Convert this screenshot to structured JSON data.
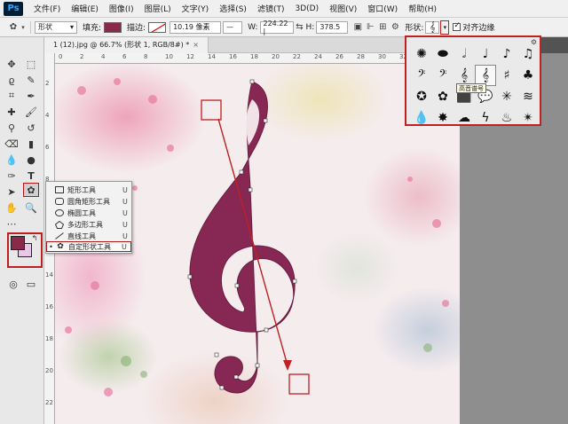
{
  "app": {
    "logo": "Ps"
  },
  "menu": [
    "文件(F)",
    "编辑(E)",
    "图像(I)",
    "图层(L)",
    "文字(Y)",
    "选择(S)",
    "滤镜(T)",
    "3D(D)",
    "视图(V)",
    "窗口(W)",
    "帮助(H)"
  ],
  "options": {
    "mode": "形状",
    "fill_label": "填充:",
    "fill_color": "#8a2a4a",
    "stroke_label": "描边:",
    "stroke_width": "10.19 像素",
    "w_label": "W:",
    "w_value": "224.22 |",
    "h_label": "H:",
    "h_value": "378.5",
    "shape_label": "形状:",
    "align_edges": "对齐边缘"
  },
  "tab": {
    "label": "1 (12).jpg @ 66.7% (形状 1, RGB/8#) *",
    "close": "×"
  },
  "ruler": {
    "top": [
      "0",
      "2",
      "4",
      "6",
      "8",
      "10",
      "12",
      "14",
      "16",
      "18",
      "20",
      "22",
      "24",
      "26",
      "28",
      "30",
      "32",
      "34",
      "36"
    ],
    "left": [
      "2",
      "4",
      "6",
      "8",
      "10",
      "12",
      "14",
      "16",
      "18",
      "20",
      "22"
    ]
  },
  "flyout": {
    "items": [
      {
        "label": "矩形工具",
        "key": "U",
        "icon": "rectangle-icon"
      },
      {
        "label": "圆角矩形工具",
        "key": "U",
        "icon": "rounded-rectangle-icon"
      },
      {
        "label": "椭圆工具",
        "key": "U",
        "icon": "ellipse-icon"
      },
      {
        "label": "多边形工具",
        "key": "U",
        "icon": "polygon-icon"
      },
      {
        "label": "直线工具",
        "key": "U",
        "icon": "line-icon"
      },
      {
        "label": "自定形状工具",
        "key": "U",
        "icon": "custom-shape-icon",
        "selected": true
      }
    ]
  },
  "picker": {
    "shapes": [
      "✺",
      "⬬",
      "𝅗𝅥",
      "♩",
      "♪",
      "♫",
      "𝄢",
      "𝄢",
      "𝄞",
      "𝄞",
      "♯",
      "♣",
      "✪",
      "✿",
      "⬛",
      "💬",
      "✳",
      "≋",
      "💧",
      "✸",
      "☁",
      "ϟ",
      "♨",
      "✴"
    ],
    "tooltip": "高音谱号"
  }
}
